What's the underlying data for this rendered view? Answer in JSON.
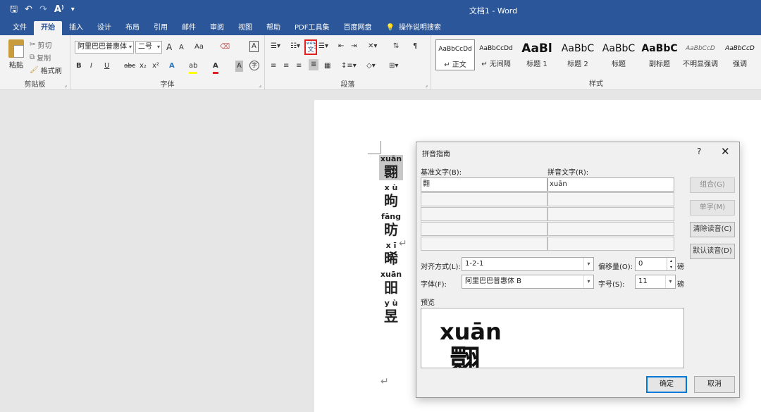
{
  "titlebar": {
    "qat_icons": [
      "save-icon",
      "undo-icon",
      "redo-icon",
      "read-aloud-icon",
      "customize-icon"
    ],
    "doc_title": "文档1  -  Word"
  },
  "tabs": [
    "文件",
    "开始",
    "插入",
    "设计",
    "布局",
    "引用",
    "邮件",
    "审阅",
    "视图",
    "帮助",
    "PDF工具集",
    "百度网盘"
  ],
  "tellme": "操作说明搜索",
  "ribbon": {
    "clipboard": {
      "paste": "粘贴",
      "cut": "剪切",
      "copy": "复制",
      "format_painter": "格式刷",
      "label": "剪贴板"
    },
    "font": {
      "name": "阿里巴巴普惠体",
      "size": "二号",
      "grow": "A",
      "shrink": "A",
      "case": "Aa",
      "bold": "B",
      "italic": "I",
      "underline": "U",
      "strike": "abc",
      "sub": "x₂",
      "sup": "x²",
      "effects": "A",
      "highlight": "ab",
      "color": "A",
      "shading": "A",
      "enclose": "字",
      "pinyin_top": "wén",
      "pinyin_bottom": "文",
      "border_char": "A",
      "label": "字体"
    },
    "paragraph": {
      "label": "段落"
    },
    "styles": {
      "label": "样式",
      "items": [
        {
          "sample": "AaBbCcDd",
          "name": "正文"
        },
        {
          "sample": "AaBbCcDd",
          "name": "无间隔"
        },
        {
          "sample": "AaBl",
          "name": "标题 1"
        },
        {
          "sample": "AaBbC",
          "name": "标题 2"
        },
        {
          "sample": "AaBbC",
          "name": "标题"
        },
        {
          "sample": "AaBbC",
          "name": "副标题"
        },
        {
          "sample": "AaBbCcD",
          "name": "不明显强调"
        },
        {
          "sample": "AaBbCcD",
          "name": "强调"
        }
      ]
    }
  },
  "document": {
    "chars": [
      {
        "py": "xuān",
        "hz": "翾"
      },
      {
        "py": "x ù",
        "hz": "昫"
      },
      {
        "py": "fāng",
        "hz": "昉"
      },
      {
        "py": "x ī",
        "hz": "晞"
      },
      {
        "py": "xuān",
        "hz": "昍"
      },
      {
        "py": "y ù",
        "hz": "昱"
      }
    ],
    "return_mark": "↵"
  },
  "dialog": {
    "title": "拼音指南",
    "help": "?",
    "close": "✕",
    "base_label": "基准文字(B):",
    "ruby_label": "拼音文字(R):",
    "base_text": "翾",
    "ruby_text": "xuān",
    "buttons": {
      "group": "组合(G)",
      "mono": "单字(M)",
      "clear": "清除读音(C)",
      "default": "默认读音(D)"
    },
    "align_label": "对齐方式(L):",
    "align_value": "1-2-1",
    "offset_label": "偏移量(O):",
    "offset_value": "0",
    "offset_unit": "磅",
    "font_label": "字体(F):",
    "font_value": "阿里巴巴普惠体 B",
    "size_label": "字号(S):",
    "size_value": "11",
    "size_unit": "磅",
    "preview_label": "预览",
    "preview_py": "xuān",
    "preview_hz": "翾",
    "ok": "确定",
    "cancel": "取消"
  }
}
